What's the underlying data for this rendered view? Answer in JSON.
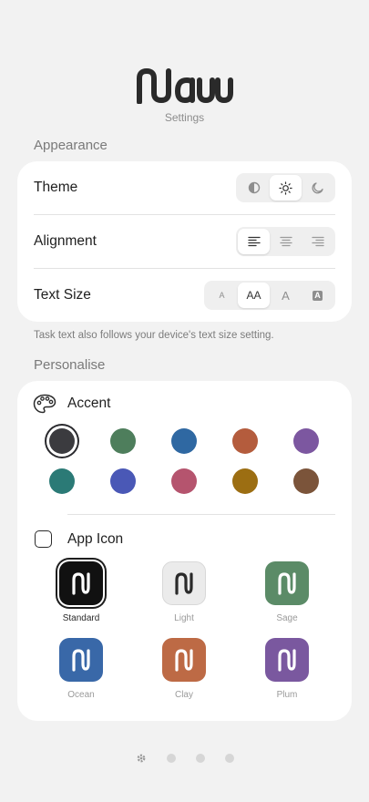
{
  "app": {
    "logo_text": "Nauu",
    "subtitle": "Settings"
  },
  "appearance": {
    "title": "Appearance",
    "theme": {
      "label": "Theme",
      "options": [
        "contrast-icon",
        "sun-icon",
        "moon-icon"
      ],
      "selected": 1
    },
    "alignment": {
      "label": "Alignment",
      "options": [
        "align-left-icon",
        "align-center-icon",
        "align-right-icon"
      ],
      "selected": 0
    },
    "text_size": {
      "label": "Text Size",
      "options": [
        "A",
        "AA",
        "A",
        "A"
      ],
      "selected": 1
    },
    "note": "Task text also follows your device's text size setting."
  },
  "personalise": {
    "title": "Personalise",
    "accent": {
      "label": "Accent",
      "colors": [
        "#3b3b3f",
        "#4e7e5c",
        "#2f68a2",
        "#b45c3d",
        "#7c57a0",
        "#2b7a76",
        "#4a58b6",
        "#b5546e",
        "#9c6e12",
        "#7b543a"
      ],
      "selected": 0
    },
    "app_icon": {
      "label": "App Icon",
      "icons": [
        {
          "name": "Standard",
          "bg": "#111111",
          "fg": "#ffffff"
        },
        {
          "name": "Light",
          "bg": "#ebebeb",
          "fg": "#2a2a2a"
        },
        {
          "name": "Sage",
          "bg": "#5b8b67",
          "fg": "#ffffff"
        },
        {
          "name": "Ocean",
          "bg": "#3968a8",
          "fg": "#ffffff"
        },
        {
          "name": "Clay",
          "bg": "#bd6a45",
          "fg": "#ffffff"
        },
        {
          "name": "Plum",
          "bg": "#7a589f",
          "fg": "#ffffff"
        }
      ],
      "selected": 0
    }
  },
  "pager": {
    "pages": 4,
    "current": 0
  }
}
